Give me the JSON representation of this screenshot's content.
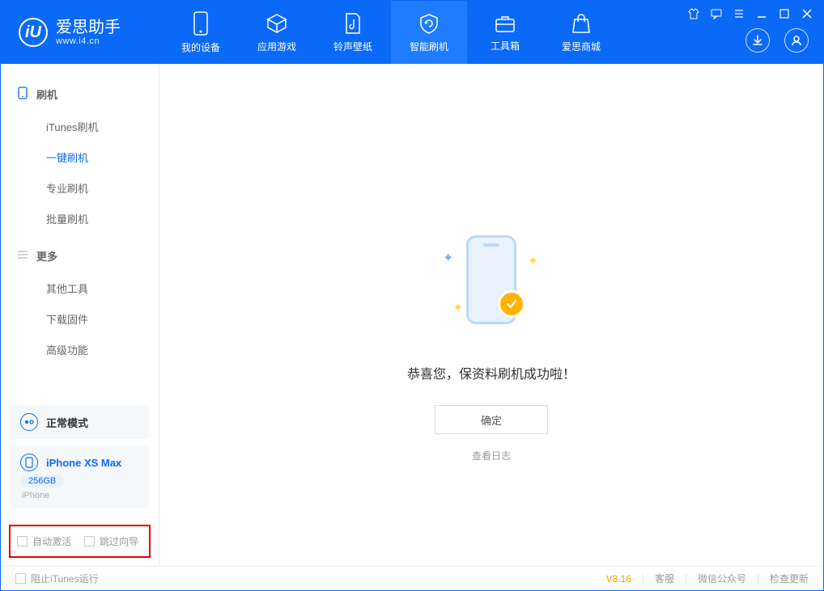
{
  "brand": {
    "title": "爱思助手",
    "sub": "www.i4.cn"
  },
  "tabs": [
    {
      "label": "我的设备"
    },
    {
      "label": "应用游戏"
    },
    {
      "label": "铃声壁纸"
    },
    {
      "label": "智能刷机"
    },
    {
      "label": "工具箱"
    },
    {
      "label": "爱思商城"
    }
  ],
  "sidebar": {
    "flash_head": "刷机",
    "flash_items": [
      {
        "label": "iTunes刷机"
      },
      {
        "label": "一键刷机"
      },
      {
        "label": "专业刷机"
      },
      {
        "label": "批量刷机"
      }
    ],
    "more_head": "更多",
    "more_items": [
      {
        "label": "其他工具"
      },
      {
        "label": "下载固件"
      },
      {
        "label": "高级功能"
      }
    ],
    "mode_card": "正常模式",
    "device": {
      "name": "iPhone XS Max",
      "storage": "256GB",
      "type": "iPhone"
    },
    "bottom_opts": {
      "auto_activate": "自动激活",
      "skip_guide": "跳过向导"
    }
  },
  "main": {
    "success_text": "恭喜您，保资料刷机成功啦！",
    "ok": "确定",
    "view_log": "查看日志"
  },
  "footer": {
    "block_itunes": "阻止iTunes运行",
    "version": "V8.16",
    "support": "客服",
    "wechat": "微信公众号",
    "check_update": "检查更新"
  }
}
